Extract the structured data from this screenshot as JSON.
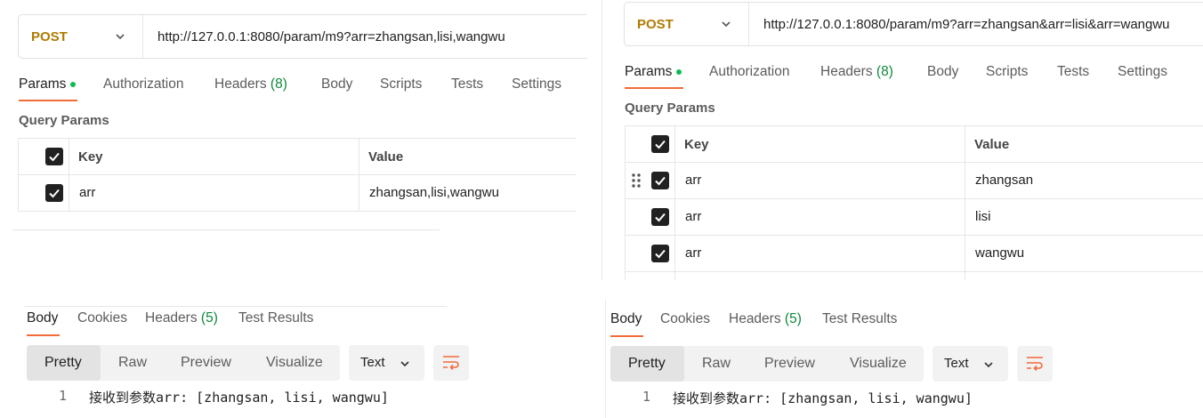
{
  "left": {
    "request": {
      "method": "POST",
      "url": "http://127.0.0.1:8080/param/m9?arr=zhangsan,lisi,wangwu"
    },
    "tabs": [
      {
        "label": "Params"
      },
      {
        "label": "Authorization"
      },
      {
        "label": "Headers",
        "count": "(8)"
      },
      {
        "label": "Body"
      },
      {
        "label": "Scripts"
      },
      {
        "label": "Tests"
      },
      {
        "label": "Settings"
      }
    ],
    "section_title": "Query Params",
    "table": {
      "headers": [
        "Key",
        "Value"
      ],
      "rows": [
        {
          "key": "arr",
          "value": "zhangsan,lisi,wangwu"
        }
      ]
    },
    "response": {
      "tabs": [
        {
          "label": "Body"
        },
        {
          "label": "Cookies"
        },
        {
          "label": "Headers",
          "count": "(5)"
        },
        {
          "label": "Test Results"
        }
      ],
      "view_modes": [
        "Pretty",
        "Raw",
        "Preview",
        "Visualize"
      ],
      "format": "Text",
      "line_number": "1",
      "line_text": "接收到参数arr: [zhangsan, lisi, wangwu]"
    }
  },
  "right": {
    "request": {
      "method": "POST",
      "url": "http://127.0.0.1:8080/param/m9?arr=zhangsan&arr=lisi&arr=wangwu"
    },
    "tabs": [
      {
        "label": "Params"
      },
      {
        "label": "Authorization"
      },
      {
        "label": "Headers",
        "count": "(8)"
      },
      {
        "label": "Body"
      },
      {
        "label": "Scripts"
      },
      {
        "label": "Tests"
      },
      {
        "label": "Settings"
      }
    ],
    "section_title": "Query Params",
    "table": {
      "headers": [
        "Key",
        "Value"
      ],
      "rows": [
        {
          "key": "arr",
          "value": "zhangsan"
        },
        {
          "key": "arr",
          "value": "lisi"
        },
        {
          "key": "arr",
          "value": "wangwu"
        }
      ]
    },
    "response": {
      "tabs": [
        {
          "label": "Body"
        },
        {
          "label": "Cookies"
        },
        {
          "label": "Headers",
          "count": "(5)"
        },
        {
          "label": "Test Results"
        }
      ],
      "view_modes": [
        "Pretty",
        "Raw",
        "Preview",
        "Visualize"
      ],
      "format": "Text",
      "line_number": "1",
      "line_text": "接收到参数arr: [zhangsan, lisi, wangwu]"
    }
  },
  "colors": {
    "method": "#b07a00",
    "active_underline": "#f26b3a",
    "param_dot": "#0cbb52",
    "header_count": "#0e8a3a"
  },
  "icons": [
    "chevron-down-icon",
    "checkbox-checked-icon",
    "drag-handle-icon",
    "wrap-lines-icon"
  ]
}
